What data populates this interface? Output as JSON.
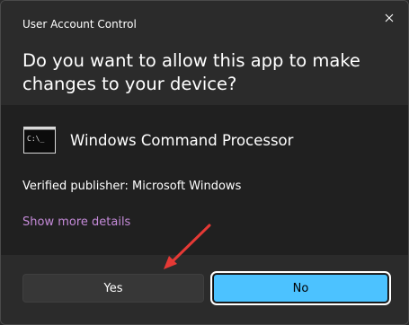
{
  "window": {
    "title": "User Account Control",
    "close_icon": "close-icon"
  },
  "prompt": {
    "question": "Do you want to allow this app to make changes to your device?"
  },
  "app": {
    "icon": "command-prompt-icon",
    "icon_text": "C:\\_",
    "name": "Windows Command Processor",
    "publisher": "Verified publisher: Microsoft Windows",
    "more_details": "Show more details"
  },
  "buttons": {
    "yes_label": "Yes",
    "no_label": "No"
  },
  "colors": {
    "link": "#c48ad8",
    "primary": "#4cc2ff",
    "annotation_arrow": "#e53935"
  }
}
